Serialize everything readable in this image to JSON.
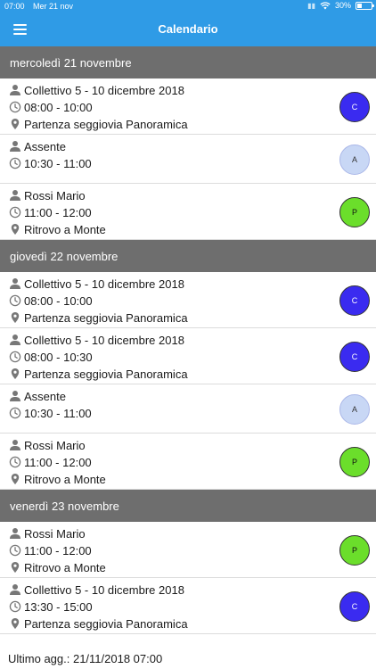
{
  "status": {
    "time": "07:00",
    "date": "Mer 21 nov",
    "battery": "30%",
    "battery_level": 0.3
  },
  "nav": {
    "title": "Calendario"
  },
  "days": [
    {
      "header": "mercoledì 21 novembre",
      "events": [
        {
          "title": "Collettivo 5 - 10 dicembre 2018",
          "time": "08:00 - 10:00",
          "place": "Partenza seggiovia Panoramica",
          "badge": "C"
        },
        {
          "title": "Assente",
          "time": "10:30 - 11:00",
          "place": "",
          "badge": "A"
        },
        {
          "title": "Rossi Mario",
          "time": "11:00 - 12:00",
          "place": "Ritrovo a Monte",
          "badge": "P"
        }
      ]
    },
    {
      "header": "giovedì 22 novembre",
      "events": [
        {
          "title": "Collettivo 5 - 10 dicembre 2018",
          "time": "08:00 - 10:00",
          "place": "Partenza seggiovia Panoramica",
          "badge": "C"
        },
        {
          "title": "Collettivo 5 - 10 dicembre 2018",
          "time": "08:00 - 10:30",
          "place": "Partenza seggiovia Panoramica",
          "badge": "C"
        },
        {
          "title": "Assente",
          "time": "10:30 - 11:00",
          "place": "",
          "badge": "A"
        },
        {
          "title": "Rossi Mario",
          "time": "11:00 - 12:00",
          "place": "Ritrovo a Monte",
          "badge": "P"
        }
      ]
    },
    {
      "header": "venerdì 23 novembre",
      "events": [
        {
          "title": "Rossi Mario",
          "time": "11:00 - 12:00",
          "place": "Ritrovo a Monte",
          "badge": "P"
        },
        {
          "title": "Collettivo 5 - 10 dicembre 2018",
          "time": "13:30 - 15:00",
          "place": "Partenza seggiovia Panoramica",
          "badge": "C"
        }
      ]
    }
  ],
  "footer": {
    "last_update": "Ultimo agg.: 21/11/2018 07:00"
  },
  "colors": {
    "navbar": "#2f9be6",
    "day_header": "#6e6e6e",
    "badge_c": "#3a2bf0",
    "badge_a": "#c8d7f5",
    "badge_p": "#6bde2b"
  },
  "icons": {
    "person": "person-icon",
    "clock": "clock-icon",
    "place": "location-pin-icon",
    "menu": "hamburger-menu-icon",
    "wifi": "wifi-icon",
    "battery": "battery-icon"
  }
}
